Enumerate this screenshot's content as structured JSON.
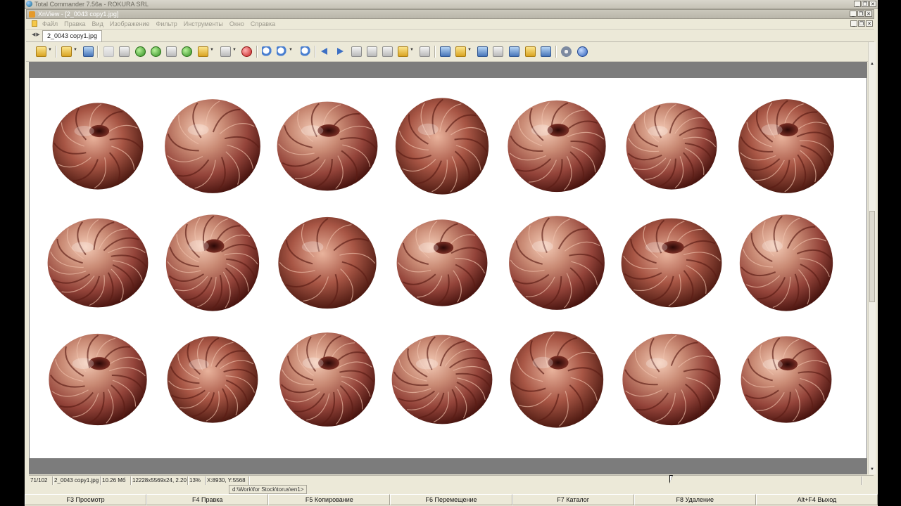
{
  "tc_window": {
    "title": "Total Commander 7.56a - ROKURA SRL"
  },
  "xnview_window": {
    "title": "XnView - [2_0043 copy1.jpg]"
  },
  "menu": [
    "Файл",
    "Правка",
    "Вид",
    "Изображение",
    "Фильтр",
    "Инструменты",
    "Окно",
    "Справка"
  ],
  "document_tab": {
    "label": "2_0043 copy1.jpg"
  },
  "toolbar": {
    "icons": [
      "browser-icon",
      "open-folder-icon",
      "save-icon",
      "undo-icon",
      "crop-icon",
      "rotate-left-icon",
      "rotate-right-icon",
      "resize-icon",
      "adjust-icon",
      "filter-icon",
      "fullscreen-icon",
      "capture-icon",
      "zoom-in-icon",
      "zoom-fit-icon",
      "zoom-out-icon",
      "previous-icon",
      "next-icon",
      "first-icon",
      "last-icon",
      "slideshow-icon",
      "print-preview-icon",
      "compare-icon",
      "properties-icon",
      "find-icon",
      "print-icon",
      "scan-icon",
      "convert-icon",
      "email-icon",
      "settings-icon",
      "about-icon"
    ]
  },
  "image": {
    "description_colors": {
      "background": "#ffffff",
      "copper_light": "#f2c3ad",
      "copper_mid": "#b5614d",
      "copper_dark": "#5a1b14"
    },
    "grid": {
      "rows": 3,
      "columns": 7
    }
  },
  "statusbar": {
    "index": "71/102",
    "filename": "2_0043 copy1.jpg",
    "filesize": "10.26 Мб",
    "dimensions": "12228x5569x24, 2.20",
    "zoom": "13%",
    "coords": "X:8930, Y:5568"
  },
  "path": "d:\\Work\\for Stock\\torus\\en1>",
  "fkeys": [
    "F3 Просмотр",
    "F4 Правка",
    "F5 Копирование",
    "F6 Перемещение",
    "F7 Каталог",
    "F8 Удаление",
    "Alt+F4 Выход"
  ]
}
